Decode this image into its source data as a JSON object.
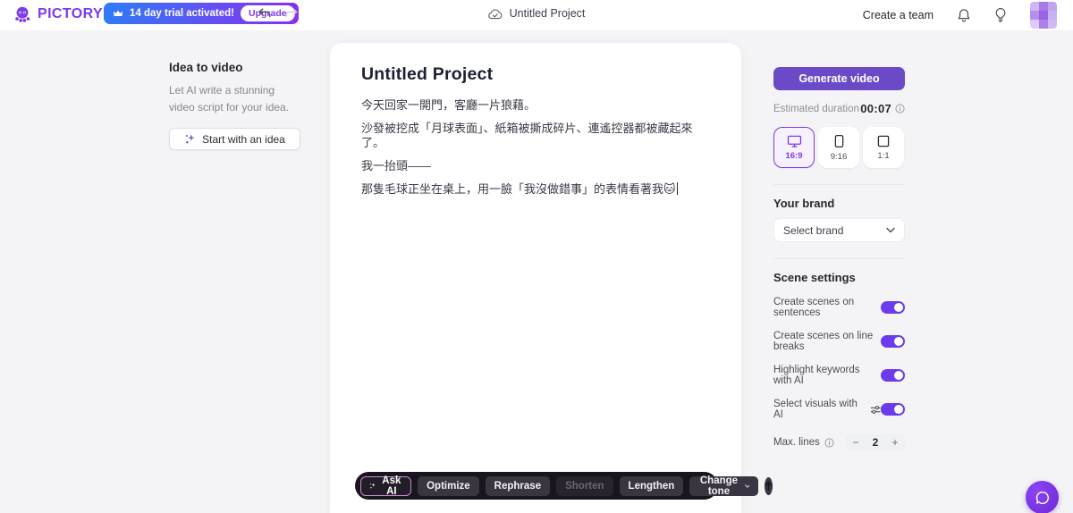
{
  "header": {
    "logo_text": "PICTORY",
    "trial_banner": {
      "text": "14 day trial activated!",
      "upgrade_label": "Upgrade"
    },
    "project_name": "Untitled Project",
    "create_team_label": "Create a team"
  },
  "sidebar": {
    "title": "Idea to video",
    "description": "Let AI write a stunning video script for your idea.",
    "cta_label": "Start with an idea"
  },
  "editor": {
    "title": "Untitled Project",
    "paragraphs": [
      "今天回家一開門，客廳一片狼藉。",
      "沙發被挖成「月球表面」、紙箱被撕成碎片、連遙控器都被藏起來了。",
      "我一抬頭——",
      "那隻毛球正坐在桌上，用一臉「我沒做錯事」的表情看著我🐱"
    ],
    "toolbar": {
      "ask_ai": "Ask AI",
      "optimize": "Optimize",
      "rephrase": "Rephrase",
      "shorten": "Shorten",
      "lengthen": "Lengthen",
      "change_tone": "Change tone"
    }
  },
  "settings_panel": {
    "generate_label": "Generate video",
    "estimated_duration_label": "Estimated duration",
    "estimated_duration_value": "00:07",
    "aspect_ratios": [
      {
        "label": "16:9",
        "selected": true
      },
      {
        "label": "9:16",
        "selected": false
      },
      {
        "label": "1:1",
        "selected": false
      }
    ],
    "brand": {
      "title": "Your brand",
      "select_placeholder": "Select brand"
    },
    "scene_settings": {
      "title": "Scene settings",
      "toggles": [
        {
          "label": "Create scenes on sentences",
          "on": true
        },
        {
          "label": "Create scenes on line breaks",
          "on": true
        },
        {
          "label": "Highlight keywords with AI",
          "on": true
        },
        {
          "label": "Select visuals with AI",
          "on": true
        }
      ],
      "max_lines": {
        "label": "Max. lines",
        "value": "2"
      }
    }
  },
  "colors": {
    "accent": "#7c3aed",
    "generate_button": "#6b4ac7",
    "trial_gradient_start": "#2f7bf5",
    "trial_gradient_end": "#8a2ff0",
    "toolbar_bg": "#18161c",
    "page_bg": "#f4f4f6"
  }
}
